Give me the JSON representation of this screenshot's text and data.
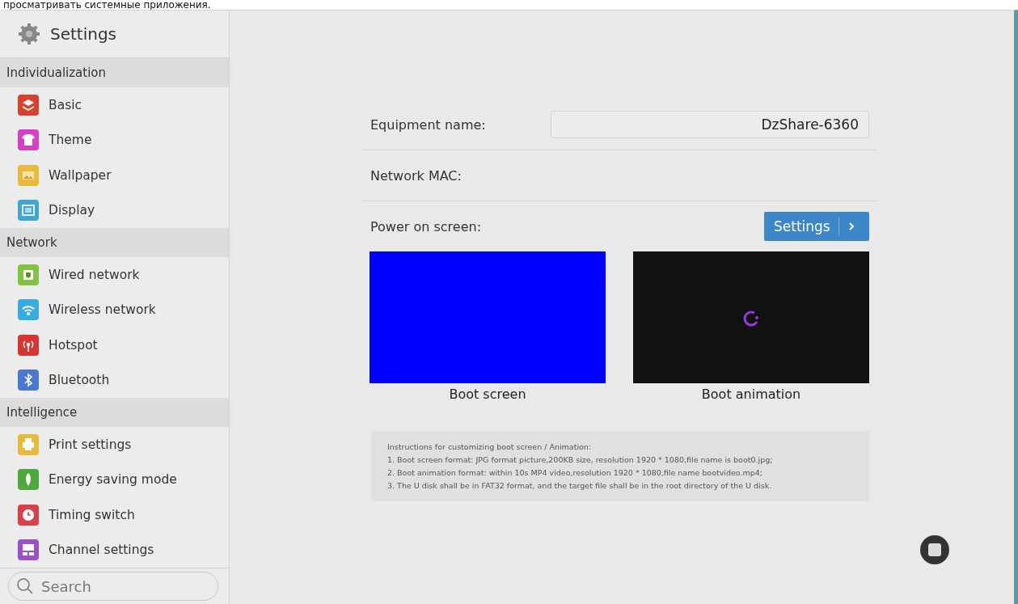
{
  "caption": "просматривать системные приложения.",
  "sidebar": {
    "title": "Settings",
    "sections": [
      {
        "heading": "Individualization",
        "items": [
          {
            "label": "Basic",
            "kind": "layers",
            "color": "#d9412f"
          },
          {
            "label": "Theme",
            "kind": "shirt",
            "color": "#d43fc3"
          },
          {
            "label": "Wallpaper",
            "kind": "picture",
            "color": "#e8b93a"
          },
          {
            "label": "Display",
            "kind": "monitor",
            "color": "#3aa9d6"
          }
        ]
      },
      {
        "heading": "Network",
        "items": [
          {
            "label": "Wired network",
            "kind": "ethernet",
            "color": "#82c341"
          },
          {
            "label": "Wireless network",
            "kind": "wifi",
            "color": "#35ade0"
          },
          {
            "label": "Hotspot",
            "kind": "antenna",
            "color": "#d93434"
          },
          {
            "label": "Bluetooth",
            "kind": "bluetooth",
            "color": "#4a78d0"
          }
        ]
      },
      {
        "heading": "Intelligence",
        "items": [
          {
            "label": "Print settings",
            "kind": "printer",
            "color": "#e8b93a"
          },
          {
            "label": "Energy saving mode",
            "kind": "leaf",
            "color": "#4ea93c"
          },
          {
            "label": "Timing switch",
            "kind": "clock",
            "color": "#d6404a"
          },
          {
            "label": "Channel settings",
            "kind": "channels",
            "color": "#9b4fc8"
          }
        ]
      }
    ],
    "search": {
      "placeholder": "Search"
    }
  },
  "main": {
    "rows": [
      {
        "label": "Equipment name:",
        "kind": "field",
        "value": "DzShare-6360"
      },
      {
        "label": "Network MAC:",
        "kind": "plain"
      },
      {
        "label": "Power on screen:",
        "kind": "button",
        "button": "Settings"
      }
    ],
    "previews": [
      {
        "caption": "Boot screen",
        "kind": "blue"
      },
      {
        "caption": "Boot animation",
        "kind": "loading"
      }
    ],
    "instructions": {
      "title": "Instructions for customizing boot screen / Animation:",
      "lines": [
        "1. Boot screen format: JPG format picture,200KB size, resolution 1920 * 1080,file name is boot0.jpg;",
        "2. Boot animation format: within 10s MP4 video,resolution 1920 * 1080,file name bootvideo.mp4;",
        "3. The U disk shall be in FAT32 format, and the target file shall be in the root directory of the U disk."
      ]
    }
  }
}
